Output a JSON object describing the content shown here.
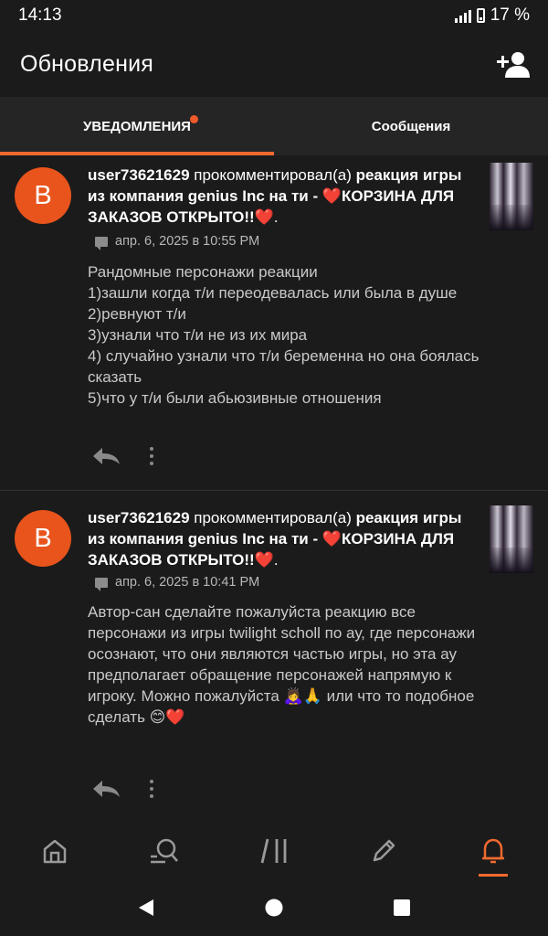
{
  "status": {
    "time": "14:13",
    "battery": "17 %"
  },
  "header": {
    "title": "Обновления"
  },
  "tabs": [
    {
      "label": "УВЕДОМЛЕНИЯ",
      "active": true,
      "has_dot": true
    },
    {
      "label": "Сообщения",
      "active": false
    }
  ],
  "notifications": [
    {
      "avatar_letter": "B",
      "user": "user73621629",
      "action": " прокомментировал(а) ",
      "story_title": "реакция игры из компания genius Inc на ти - ❤️КОРЗИНА ДЛЯ ЗАКАЗОВ ОТКРЫТО!!❤️",
      "tail": ".",
      "date": "апр. 6, 2025 в 10:55 PM",
      "text": "Рандомные персонажи реакции\n1)зашли когда т/и переодевалась или была в душе\n2)ревнуют т/и\n3)узнали что т/и не из их мира\n4) случайно узнали что т/и беременна но она боялась сказать\n5)что у т/и были абьюзивные отношения"
    },
    {
      "avatar_letter": "B",
      "user": "user73621629",
      "action": " прокомментировал(а) ",
      "story_title": "реакция игры из компания genius Inc на ти - ❤️КОРЗИНА ДЛЯ ЗАКАЗОВ ОТКРЫТО!!❤️",
      "tail": ".",
      "date": "апр. 6, 2025 в 10:41 PM",
      "text": "Автор-сан сделайте пожалуйста реакцию все персонажи из игры twilight scholl   по ау, где персонажи осознают, что они являются частью игры, но эта ау предполагает обращение персонажей напрямую к игроку. Можно пожалуйста 🙇‍♀️🙏 или что то подобное сделать 😊❤️"
    }
  ],
  "colors": {
    "accent": "#f06a2f",
    "background": "#1b1b1b",
    "tab_bar": "#252525"
  }
}
